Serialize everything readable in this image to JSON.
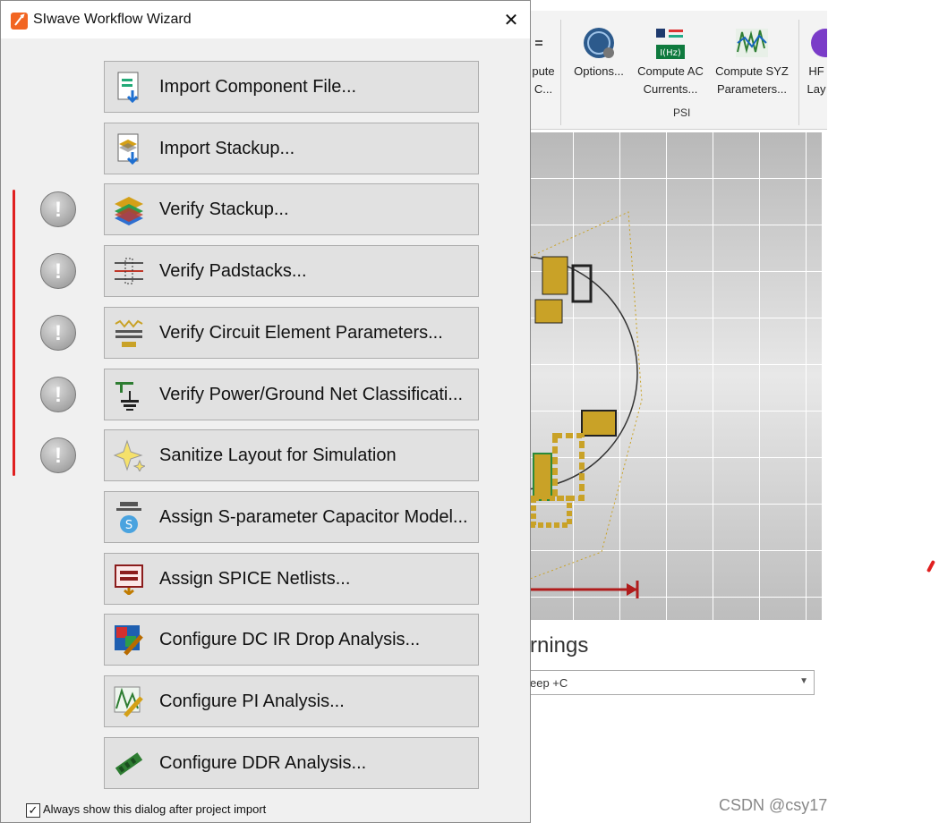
{
  "dialog": {
    "title": "SIwave Workflow Wizard",
    "close_glyph": "✕",
    "buttons": [
      {
        "label": "Import Component File...",
        "icon": "import-component-icon",
        "status": false
      },
      {
        "label": "Import Stackup...",
        "icon": "import-stackup-icon",
        "status": false
      },
      {
        "label": "Verify Stackup...",
        "icon": "stackup-layers-icon",
        "status": true
      },
      {
        "label": "Verify Padstacks...",
        "icon": "padstack-icon",
        "status": true
      },
      {
        "label": "Verify Circuit Element Parameters...",
        "icon": "circuit-element-icon",
        "status": true
      },
      {
        "label": "Verify Power/Ground Net Classificati...",
        "icon": "power-ground-icon",
        "status": true
      },
      {
        "label": "Sanitize Layout for Simulation",
        "icon": "sanitize-sparkle-icon",
        "status": true
      },
      {
        "label": "Assign S-parameter Capacitor Model...",
        "icon": "s-parameter-icon",
        "status": false
      },
      {
        "label": "Assign SPICE Netlists...",
        "icon": "spice-netlist-icon",
        "status": false
      },
      {
        "label": "Configure DC IR Drop Analysis...",
        "icon": "dc-ir-drop-icon",
        "status": false
      },
      {
        "label": "Configure PI Analysis...",
        "icon": "pi-analysis-icon",
        "status": false
      },
      {
        "label": "Configure DDR Analysis...",
        "icon": "ddr-analysis-icon",
        "status": false
      }
    ],
    "status_glyph": "!",
    "always_show_label": "Always show this dialog after project import",
    "always_show_checked": "✓"
  },
  "ribbon": {
    "partial_button": {
      "line1": "pute",
      "line2": "C..."
    },
    "options_label": "Options...",
    "compute_ac": {
      "line1": "Compute AC",
      "line2": "Currents..."
    },
    "compute_syz": {
      "line1": "Compute SYZ",
      "line2": "Parameters..."
    },
    "hfss": {
      "line1": "HF",
      "line2": "Lay"
    },
    "group_label": "PSI",
    "iz_badge": "I(Hz)"
  },
  "warnings_title": "rnings",
  "filter_value": "eep +C",
  "watermark": "CSDN @csy17"
}
